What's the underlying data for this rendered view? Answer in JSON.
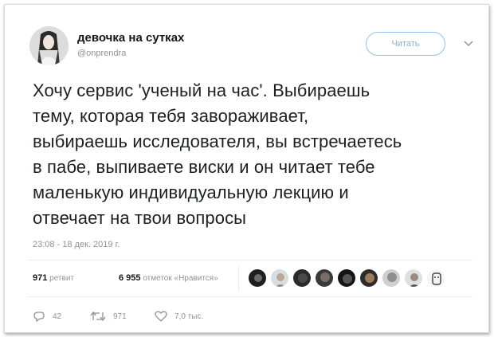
{
  "tweet": {
    "author": {
      "display_name": "девочка на сутках",
      "handle": "@onprendra"
    },
    "follow_label": "Читать",
    "text": "Хочу сервис 'ученый на час'. Выбираешь\nтему, которая тебя завораживает,\nвыбираешь исследователя, вы встречаетесь\nв пабе, выпиваете виски и он читает тебе\nмаленькую индивидуальную лекцию и\nотвечает на твои вопросы",
    "timestamp": "23:08 - 18 дек. 2019 г.",
    "stats": {
      "retweets_count": "971",
      "retweets_label": "ретвит",
      "likes_count": "6 955",
      "likes_label": "отметок «Нравится»"
    },
    "actions": {
      "replies": "42",
      "retweets": "971",
      "likes": "7,0 тыс."
    }
  },
  "icons": {
    "reply": "reply-icon",
    "retweet": "retweet-icon",
    "like": "heart-icon",
    "caret": "chevron-down-icon"
  },
  "colors": {
    "accent": "#1da1f2",
    "muted_text": "#8a949c"
  }
}
